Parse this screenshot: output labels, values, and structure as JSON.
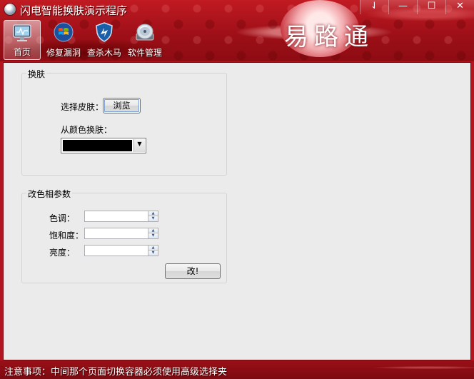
{
  "window": {
    "title": "闪电智能换肤演示程序",
    "controls": [
      "⇃",
      "—",
      "☐",
      "✕"
    ]
  },
  "logo": {
    "text": "易路通"
  },
  "nav": {
    "items": [
      {
        "label": "首页",
        "icon": "monitor-icon",
        "active": true
      },
      {
        "label": "修复漏洞",
        "icon": "windows-logo-icon",
        "active": false
      },
      {
        "label": "查杀木马",
        "icon": "shield-icon",
        "active": false
      },
      {
        "label": "软件管理",
        "icon": "disc-icon",
        "active": false
      }
    ]
  },
  "skin_group": {
    "title": "换肤",
    "select_label": "选择皮肤：",
    "browse_button": "浏览",
    "color_label": "从颜色换肤：",
    "color_value": "#000000"
  },
  "params_group": {
    "title": "改色相参数",
    "fields": [
      {
        "label": "色调：",
        "value": ""
      },
      {
        "label": "饱和度：",
        "value": ""
      },
      {
        "label": "亮度：",
        "value": ""
      }
    ],
    "apply_button": "改!"
  },
  "status": {
    "text": "注意事项：中间那个页面切换容器必须使用高级选择夹"
  },
  "colors": {
    "theme_red": "#b4161f",
    "content_bg": "#ebebeb"
  }
}
